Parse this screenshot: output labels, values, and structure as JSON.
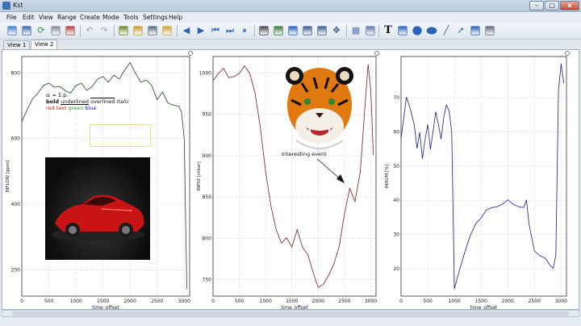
{
  "window": {
    "title": "Kst",
    "minimize_glyph": "–",
    "maximize_glyph": "□",
    "close_glyph": "x"
  },
  "menu": [
    "File",
    "Edit",
    "View",
    "Range",
    "Create",
    "Mode",
    "Tools",
    "Settings",
    "Help"
  ],
  "toolbar_icons": [
    {
      "name": "open-icon",
      "color": "#4a7cc2"
    },
    {
      "name": "save-icon",
      "color": "#3a66a8"
    },
    {
      "name": "reload-icon",
      "color": "#2f9a3a"
    },
    {
      "name": "print-icon",
      "color": "#7e8a96"
    },
    {
      "name": "export-icon",
      "color": "#b04040"
    },
    {
      "name": "undo-icon",
      "color": "#9aa4ae"
    },
    {
      "name": "redo-icon",
      "color": "#9aa4ae"
    },
    {
      "name": "data-manager-icon",
      "color": "#6a8a2a"
    },
    {
      "name": "data-wizard-icon",
      "color": "#c49a2a"
    },
    {
      "name": "plot-dialog-icon",
      "color": "#5a6a7a"
    },
    {
      "name": "change-data-icon",
      "color": "#c8a23a"
    },
    {
      "name": "back-icon",
      "color": "#2d64b8"
    },
    {
      "name": "forward-icon",
      "color": "#2d64b8"
    },
    {
      "name": "skip-back-icon",
      "color": "#2d64b8"
    },
    {
      "name": "skip-forward-icon",
      "color": "#2d64b8"
    },
    {
      "name": "pause-icon",
      "color": "#2d64b8"
    },
    {
      "name": "select-icon",
      "color": "#444444"
    },
    {
      "name": "zoom-icon",
      "color": "#3a7a3a"
    },
    {
      "name": "layout-mode-icon",
      "color": "#2d64b8"
    },
    {
      "name": "zoom-x-icon",
      "color": "#3a5a8a"
    },
    {
      "name": "zoom-y-icon",
      "color": "#3a5a8a"
    },
    {
      "name": "move-icon",
      "color": "#3a5a8a"
    },
    {
      "name": "grid-icon",
      "color": "#5a78a8"
    },
    {
      "name": "plot-icon",
      "color": "#5a78a8"
    },
    {
      "name": "text-tool-icon",
      "color": "#111111"
    },
    {
      "name": "box-tool-icon",
      "color": "#2d64b8"
    },
    {
      "name": "circle-tool-icon",
      "color": "#2d64b8"
    },
    {
      "name": "ellipse-tool-icon",
      "color": "#2d64b8"
    },
    {
      "name": "line-tool-icon",
      "color": "#2d64b8"
    },
    {
      "name": "arrow-tool-icon",
      "color": "#2d64b8"
    },
    {
      "name": "picture-tool-icon",
      "color": "#2d64b8"
    },
    {
      "name": "svg-tool-icon",
      "color": "#5a6a7a"
    }
  ],
  "tabs": [
    "View 1",
    "View 2"
  ],
  "active_tab": 1,
  "annotations": {
    "formula": "αᵢ = Σ.pᵢ",
    "bold": "bold",
    "underlined": "underlined",
    "overlined": "overlined",
    "italic": "italic",
    "red_text": "red text",
    "green_text": "green",
    "blue_text": "blue",
    "event_label": "Interesting event"
  },
  "colors": {
    "plot1_line": "#1f4a1f",
    "plot2_line": "#7a1f1f",
    "plot3_line": "#1a1f7a",
    "grid": "#c9c9c9",
    "red_text": "#cc2222",
    "green_text": "#22aa22",
    "blue_text": "#2222cc"
  },
  "chart_data": [
    {
      "type": "line",
      "xlabel": "time_offset",
      "ylabel": "INFLOW [gpm]",
      "xlim": [
        0,
        3100
      ],
      "ylim": [
        120,
        850
      ],
      "xticks": [
        0,
        500,
        1000,
        1500,
        2000,
        2500,
        3000
      ],
      "yticks": [
        200,
        400,
        600,
        800
      ],
      "grid": true,
      "series": [
        {
          "x": [
            0,
            100,
            200,
            300,
            400,
            500,
            600,
            700,
            800,
            900,
            1000,
            1100,
            1200,
            1300,
            1400,
            1500,
            1600,
            1700,
            1800,
            1900,
            2000,
            2100,
            2200,
            2300,
            2400,
            2500,
            2600,
            2700,
            2800,
            2900,
            2950,
            3000,
            3050
          ],
          "y": [
            650,
            690,
            720,
            740,
            760,
            770,
            755,
            760,
            745,
            740,
            760,
            770,
            745,
            760,
            780,
            790,
            770,
            795,
            780,
            810,
            830,
            800,
            770,
            780,
            760,
            720,
            740,
            710,
            700,
            700,
            680,
            600,
            140
          ]
        }
      ]
    },
    {
      "type": "line",
      "xlabel": "time_offset",
      "ylabel": "INPS2 [mbar]",
      "xlim": [
        0,
        3100
      ],
      "ylim": [
        730,
        1020
      ],
      "xticks": [
        0,
        500,
        1000,
        1500,
        2000,
        2500,
        3000
      ],
      "yticks": [
        750,
        800,
        850,
        900,
        950,
        1000
      ],
      "grid": true,
      "series": [
        {
          "x": [
            0,
            100,
            200,
            300,
            400,
            500,
            600,
            700,
            800,
            900,
            1000,
            1100,
            1200,
            1300,
            1400,
            1500,
            1600,
            1700,
            1800,
            1900,
            2000,
            2100,
            2200,
            2300,
            2400,
            2500,
            2600,
            2700,
            2800,
            2900,
            2950,
            3000,
            3050
          ],
          "y": [
            990,
            1000,
            1005,
            995,
            995,
            1000,
            1008,
            1000,
            975,
            935,
            880,
            840,
            810,
            795,
            800,
            790,
            810,
            790,
            780,
            760,
            740,
            745,
            755,
            770,
            790,
            830,
            860,
            845,
            880,
            970,
            1010,
            980,
            900
          ]
        }
      ]
    },
    {
      "type": "line",
      "xlabel": "time_offset",
      "ylabel": "INHUM [%]",
      "xlim": [
        0,
        3100
      ],
      "ylim": [
        12,
        82
      ],
      "xticks": [
        0,
        500,
        1000,
        1500,
        2000,
        2500,
        3000
      ],
      "yticks": [
        20,
        30,
        40,
        50,
        60,
        70
      ],
      "grid": true,
      "series": [
        {
          "x": [
            0,
            50,
            100,
            150,
            200,
            250,
            300,
            350,
            400,
            450,
            500,
            550,
            600,
            650,
            700,
            750,
            800,
            850,
            900,
            950,
            1000,
            1100,
            1200,
            1300,
            1400,
            1500,
            1600,
            1700,
            1800,
            1900,
            2000,
            2100,
            2200,
            2300,
            2350,
            2400,
            2500,
            2600,
            2700,
            2800,
            2850,
            2900,
            2950,
            3000,
            3050
          ],
          "y": [
            58,
            64,
            70,
            68,
            65,
            62,
            55,
            60,
            52,
            58,
            62,
            55,
            60,
            66,
            62,
            58,
            64,
            68,
            66,
            60,
            14,
            20,
            25,
            30,
            33,
            35,
            37,
            38,
            38,
            39,
            40,
            39,
            38,
            38,
            40,
            33,
            25,
            24,
            23,
            21,
            20,
            24,
            72,
            80,
            74
          ]
        }
      ]
    }
  ]
}
